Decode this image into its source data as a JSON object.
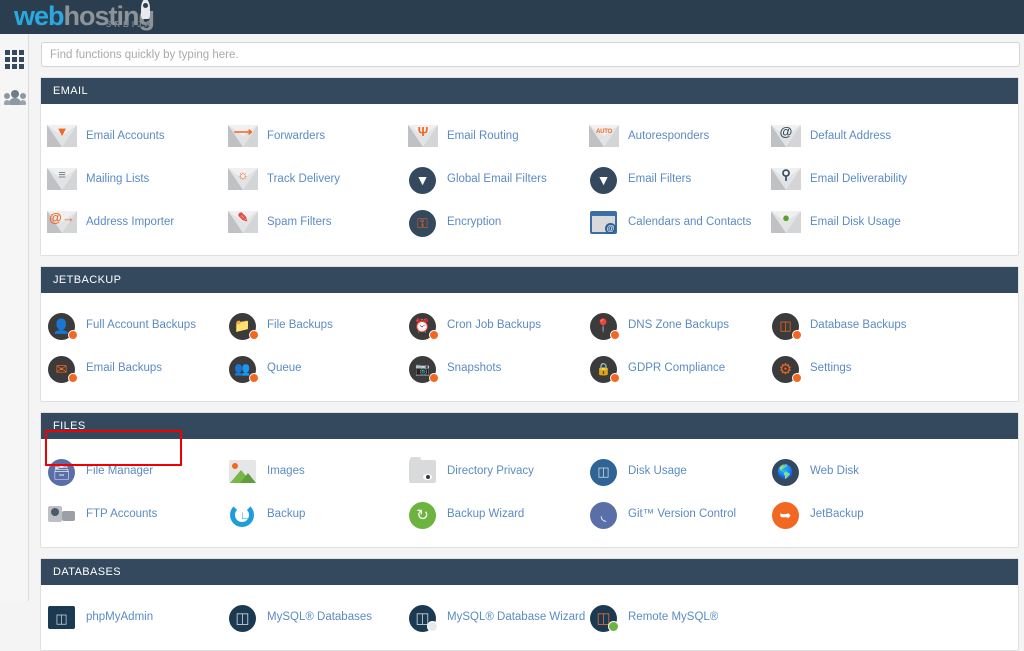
{
  "brand": {
    "name_part1": "web",
    "name_part2": "hosting",
    "subtitle": "SRBIJA",
    "accent_color": "#2aa9e0",
    "header_bg": "#2b3e50"
  },
  "rail": {
    "items": [
      {
        "name": "apps-grid",
        "icon": "grid-icon",
        "label": "Apps"
      },
      {
        "name": "users",
        "icon": "people-icon",
        "label": "Users"
      }
    ]
  },
  "search": {
    "placeholder": "Find functions quickly by typing here.",
    "value": ""
  },
  "theme": {
    "link_color": "#5b8bc4",
    "section_header_bg": "#34495e",
    "orange": "#f26722",
    "highlight_color": "#f20000"
  },
  "highlight": {
    "target": "File Manager"
  },
  "sections": [
    {
      "title": "EMAIL",
      "items": [
        {
          "label": "Email Accounts",
          "icon": "email-accounts-icon"
        },
        {
          "label": "Forwarders",
          "icon": "forwarders-icon"
        },
        {
          "label": "Email Routing",
          "icon": "email-routing-icon"
        },
        {
          "label": "Autoresponders",
          "icon": "autoresponders-icon"
        },
        {
          "label": "Default Address",
          "icon": "default-address-icon"
        },
        {
          "label": "Mailing Lists",
          "icon": "mailing-lists-icon"
        },
        {
          "label": "Track Delivery",
          "icon": "track-delivery-icon"
        },
        {
          "label": "Global Email Filters",
          "icon": "global-email-filters-icon"
        },
        {
          "label": "Email Filters",
          "icon": "email-filters-icon"
        },
        {
          "label": "Email Deliverability",
          "icon": "email-deliverability-icon"
        },
        {
          "label": "Address Importer",
          "icon": "address-importer-icon"
        },
        {
          "label": "Spam Filters",
          "icon": "spam-filters-icon"
        },
        {
          "label": "Encryption",
          "icon": "encryption-icon"
        },
        {
          "label": "Calendars and Contacts",
          "icon": "calendars-contacts-icon"
        },
        {
          "label": "Email Disk Usage",
          "icon": "email-disk-usage-icon"
        }
      ]
    },
    {
      "title": "JETBACKUP",
      "items": [
        {
          "label": "Full Account Backups",
          "icon": "full-account-backups-icon"
        },
        {
          "label": "File Backups",
          "icon": "file-backups-icon"
        },
        {
          "label": "Cron Job Backups",
          "icon": "cron-job-backups-icon"
        },
        {
          "label": "DNS Zone Backups",
          "icon": "dns-zone-backups-icon"
        },
        {
          "label": "Database Backups",
          "icon": "database-backups-icon"
        },
        {
          "label": "Email Backups",
          "icon": "email-backups-icon"
        },
        {
          "label": "Queue",
          "icon": "queue-icon"
        },
        {
          "label": "Snapshots",
          "icon": "snapshots-icon"
        },
        {
          "label": "GDPR Compliance",
          "icon": "gdpr-compliance-icon"
        },
        {
          "label": "Settings",
          "icon": "settings-icon"
        }
      ]
    },
    {
      "title": "FILES",
      "items": [
        {
          "label": "File Manager",
          "icon": "file-manager-icon"
        },
        {
          "label": "Images",
          "icon": "images-icon"
        },
        {
          "label": "Directory Privacy",
          "icon": "directory-privacy-icon"
        },
        {
          "label": "Disk Usage",
          "icon": "disk-usage-icon"
        },
        {
          "label": "Web Disk",
          "icon": "web-disk-icon"
        },
        {
          "label": "FTP Accounts",
          "icon": "ftp-accounts-icon"
        },
        {
          "label": "Backup",
          "icon": "backup-icon"
        },
        {
          "label": "Backup Wizard",
          "icon": "backup-wizard-icon"
        },
        {
          "label": "Git™ Version Control",
          "icon": "git-version-control-icon"
        },
        {
          "label": "JetBackup",
          "icon": "jetbackup-icon"
        }
      ]
    },
    {
      "title": "DATABASES",
      "items": [
        {
          "label": "phpMyAdmin",
          "icon": "phpmyadmin-icon"
        },
        {
          "label": "MySQL® Databases",
          "icon": "mysql-databases-icon"
        },
        {
          "label": "MySQL® Database Wizard",
          "icon": "mysql-database-wizard-icon"
        },
        {
          "label": "Remote MySQL®",
          "icon": "remote-mysql-icon"
        }
      ]
    }
  ]
}
